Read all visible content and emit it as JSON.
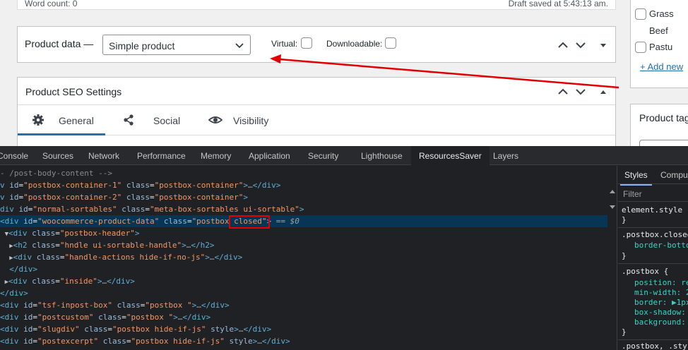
{
  "wp": {
    "word_count": "Word count: 0",
    "draft_saved": "Draft saved at 5:43:13 am.",
    "product_data": {
      "title": "Product data —",
      "type_selected": "Simple product",
      "virtual_label": "Virtual:",
      "downloadable_label": "Downloadable:"
    },
    "seo": {
      "title": "Product SEO Settings",
      "tabs": [
        {
          "label": "General",
          "icon": "gear-icon"
        },
        {
          "label": "Social",
          "icon": "share-icon"
        },
        {
          "label": "Visibility",
          "icon": "eye-icon"
        }
      ]
    },
    "sidebar": {
      "categories": [
        "Grass",
        "Beef",
        "Pastu"
      ],
      "add_new": "+ Add new",
      "tags_title": "Product tag"
    },
    "colors": {
      "accent": "#2271b1",
      "annotation_red": "#e00000"
    }
  },
  "devtools": {
    "tabs": [
      "Console",
      "Sources",
      "Network",
      "Performance",
      "Memory",
      "Application",
      "Security",
      "Lighthouse",
      "ResourcesSaver",
      "Layers"
    ],
    "active_tab": "ResourcesSaver",
    "lines": {
      "l0": "- /post-body-content -->",
      "l1_pre": "v id=",
      "l1_id": "\"postbox-container-1\"",
      "l1_cls": "\"postbox-container\"",
      "l2_id": "\"postbox-container-2\"",
      "l2_cls": "\"postbox-container\"",
      "l3_id": "\"normal-sortables\"",
      "l3_cls": "\"meta-box-sortables ui-sortable\"",
      "l4_id": "\"woocommerce-product-data\"",
      "l4_cls_a": "\"postbox ",
      "l4_cls_b": "closed",
      "l4_cls_c": "\"",
      "l4_tail": " == $0",
      "l5_cls": "\"postbox-header\"",
      "l6_cls": "\"hndle ui-sortable-handle\"",
      "l7_cls": "\"handle-actions hide-if-no-js\"",
      "l9_cls": "\"inside\"",
      "l11_id": "\"tsf-inpost-box\"",
      "l11_cls": "\"postbox \"",
      "l12_id": "\"postcustom\"",
      "l12_cls": "\"postbox \"",
      "l13_id": "\"slugdiv\"",
      "l13_cls": "\"postbox  hide-if-js\"",
      "l14_id": "\"postexcerpt\"",
      "l14_cls": "\"postbox  hide-if-js\""
    },
    "styles": {
      "tabs": [
        "Styles",
        "Compu"
      ],
      "filter_placeholder": "Filter",
      "rule1": "element.style {",
      "rule2_sel": ".postbox.closed",
      "rule2_prop": "border-botto",
      "rule3_sel": ".postbox {",
      "rule3_props": [
        "position: re",
        "min-width: 2",
        "border: ▶1px",
        "box-shadow:",
        "background:"
      ],
      "rule4_sel": ".postbox, .sty"
    }
  }
}
